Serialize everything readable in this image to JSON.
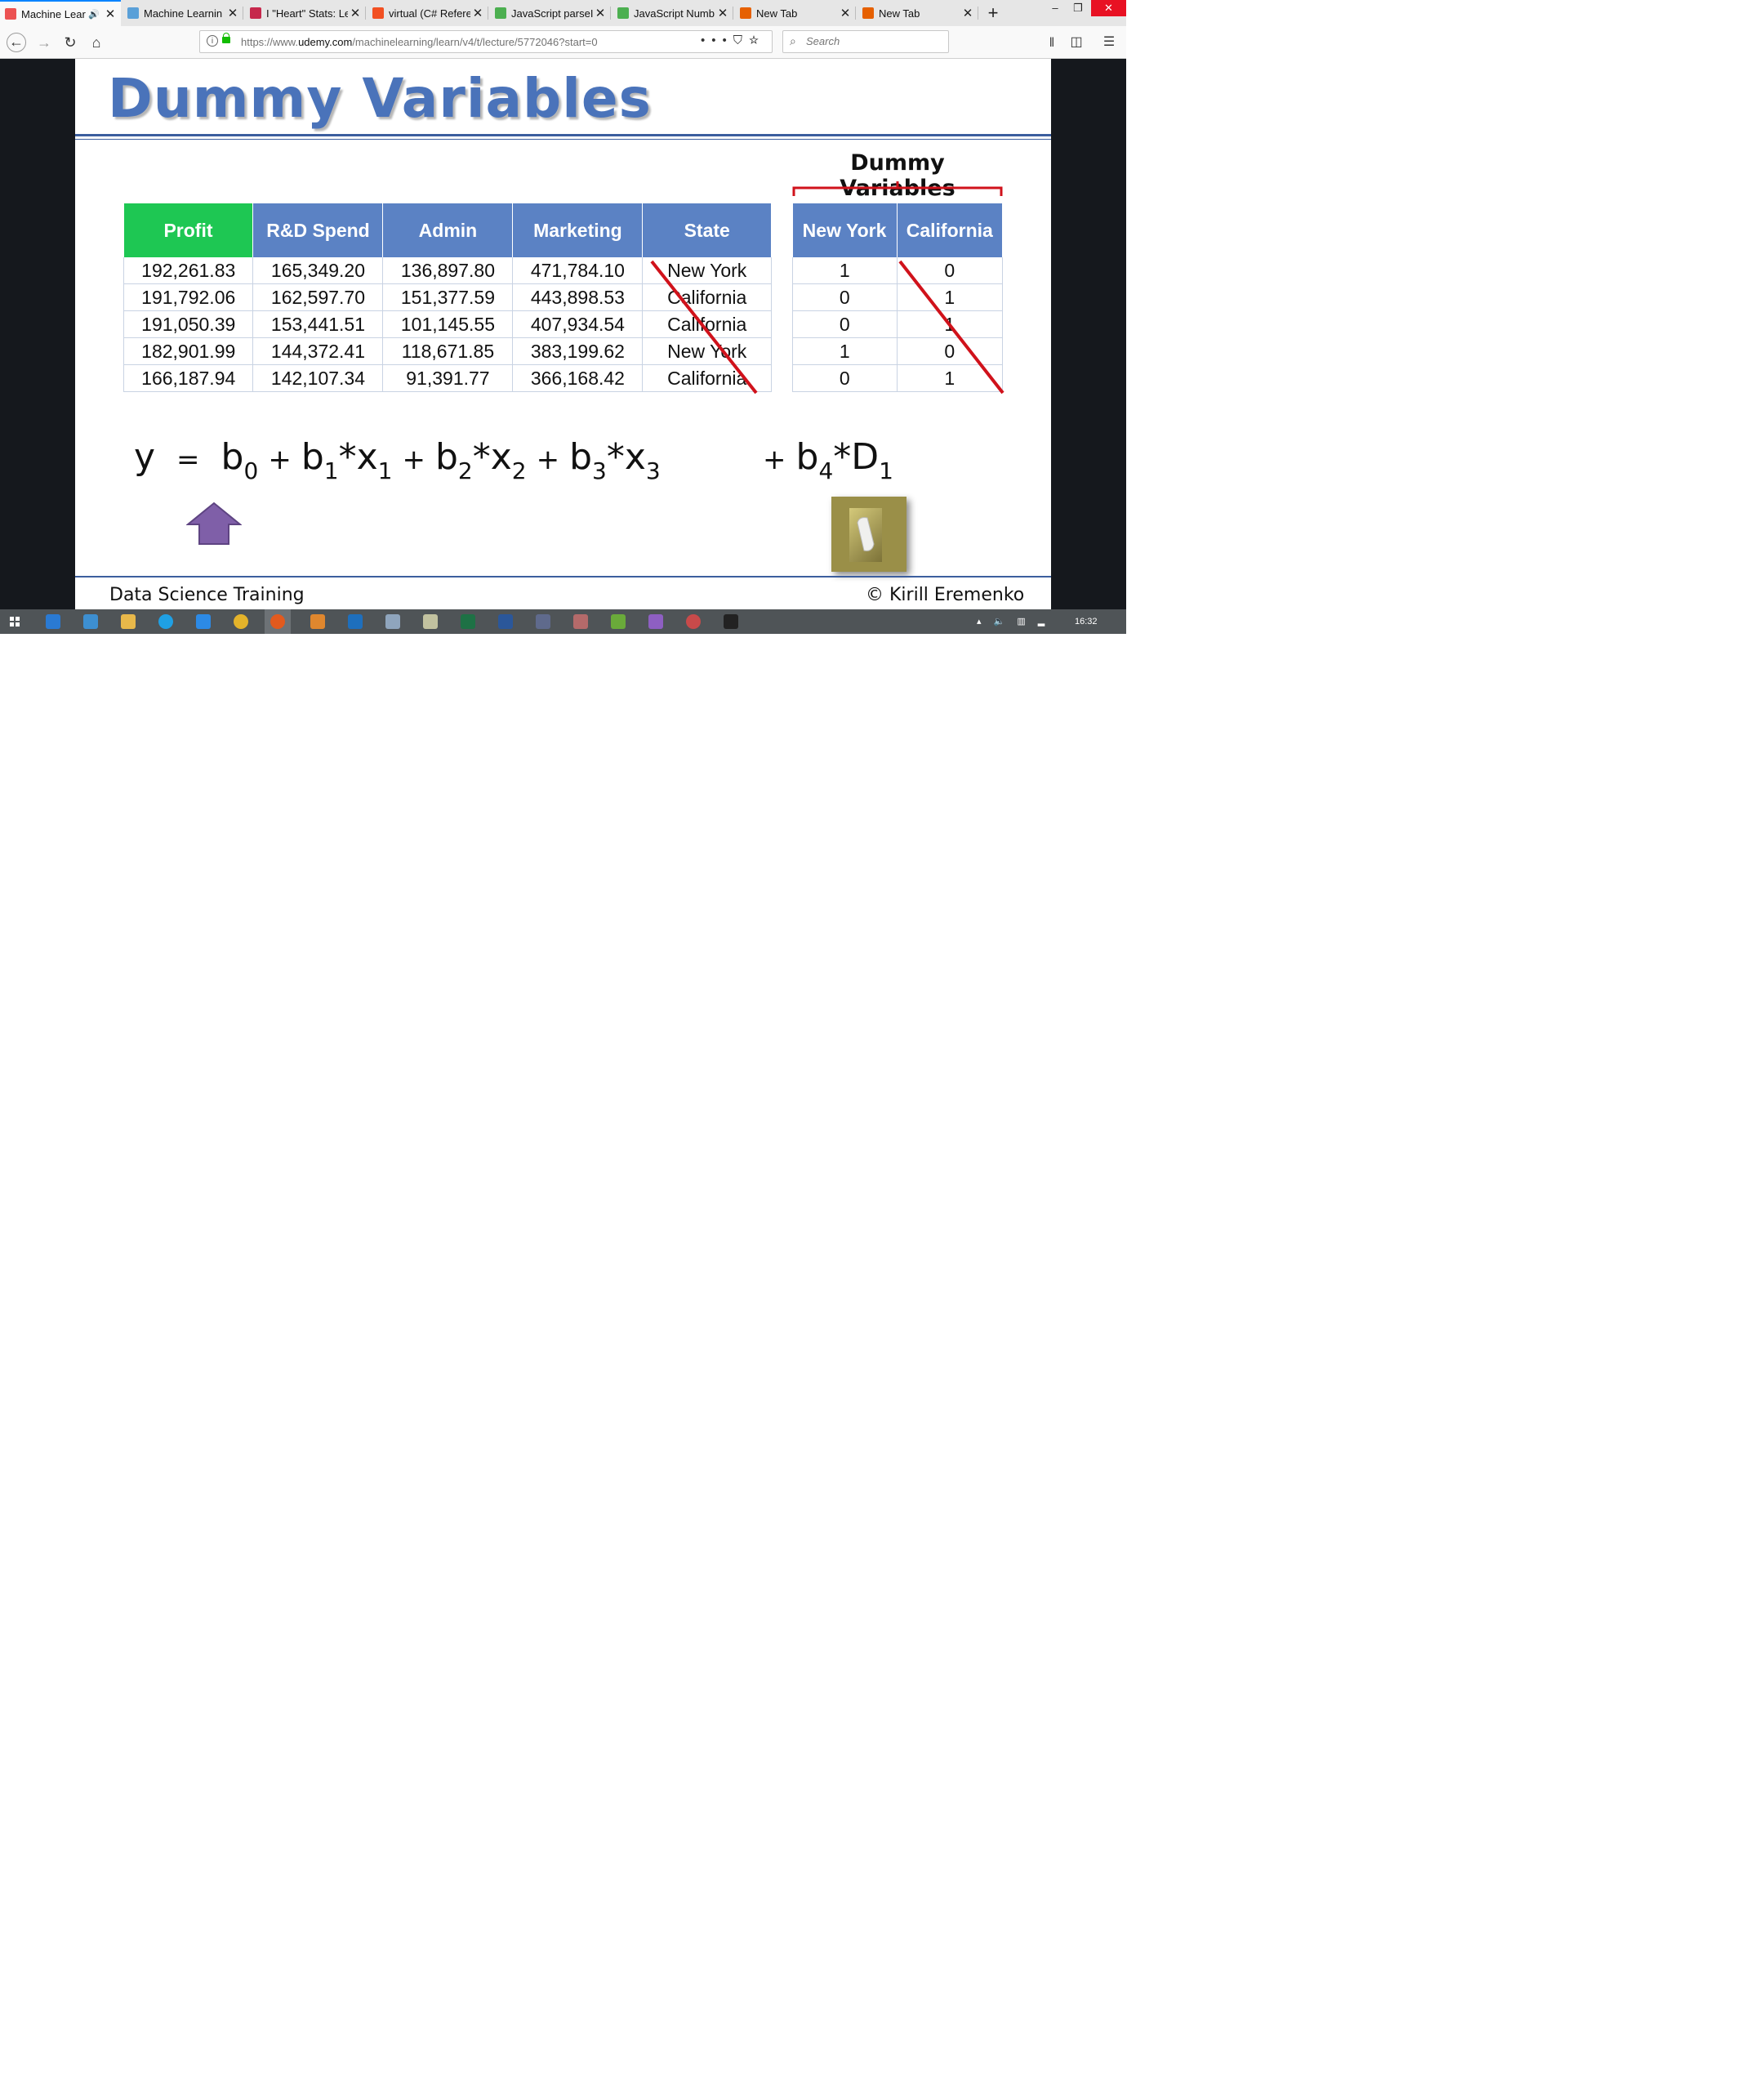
{
  "browser": {
    "tabs": [
      {
        "title": "Machine Lear",
        "active": true,
        "icon": "udemy-icon",
        "color": "#ec5252",
        "audio": true
      },
      {
        "title": "Machine Learnin",
        "active": false,
        "icon": "chat-icon",
        "color": "#5aa0d8"
      },
      {
        "title": "I \"Heart\" Stats: Le",
        "active": false,
        "icon": "edx-icon",
        "color": "#c6284c"
      },
      {
        "title": "virtual (C# Refere",
        "active": false,
        "icon": "microsoft-icon",
        "color": "#f25022"
      },
      {
        "title": "JavaScript parseI",
        "active": false,
        "icon": "w3schools-icon",
        "color": "#4caf50"
      },
      {
        "title": "JavaScript Numb",
        "active": false,
        "icon": "w3schools-icon",
        "color": "#4caf50"
      },
      {
        "title": "New Tab",
        "active": false,
        "icon": "firefox-icon",
        "color": "#e66000"
      },
      {
        "title": "New Tab",
        "active": false,
        "icon": "firefox-icon",
        "color": "#e66000"
      }
    ],
    "url_prefix": "https://www.",
    "url_domain": "udemy.com",
    "url_path": "/machinelearning/learn/v4/t/lecture/5772046?start=0",
    "search_placeholder": "Search"
  },
  "slide": {
    "title": "Dummy Variables",
    "main_table": {
      "headers": [
        "Profit",
        "R&D Spend",
        "Admin",
        "Marketing",
        "State"
      ],
      "rows": [
        [
          "192,261.83",
          "165,349.20",
          "136,897.80",
          "471,784.10",
          "New York"
        ],
        [
          "191,792.06",
          "162,597.70",
          "151,377.59",
          "443,898.53",
          "California"
        ],
        [
          "191,050.39",
          "153,441.51",
          "101,145.55",
          "407,934.54",
          "California"
        ],
        [
          "182,901.99",
          "144,372.41",
          "118,671.85",
          "383,199.62",
          "New York"
        ],
        [
          "166,187.94",
          "142,107.34",
          "91,391.77",
          "366,168.42",
          "California"
        ]
      ]
    },
    "dummy_heading": "Dummy Variables",
    "dummy_table": {
      "headers": [
        "New York",
        "California"
      ],
      "rows": [
        [
          "1",
          "0"
        ],
        [
          "0",
          "1"
        ],
        [
          "0",
          "1"
        ],
        [
          "1",
          "0"
        ],
        [
          "0",
          "1"
        ]
      ]
    },
    "equation": {
      "y": "y",
      "eq": "=",
      "terms": [
        {
          "coef": "b",
          "coef_sub": "0"
        },
        {
          "coef": "b",
          "coef_sub": "1",
          "var": "*x",
          "var_sub": "1"
        },
        {
          "coef": "b",
          "coef_sub": "2",
          "var": "*x",
          "var_sub": "2"
        },
        {
          "coef": "b",
          "coef_sub": "3",
          "var": "*x",
          "var_sub": "3"
        }
      ],
      "dummy_term": {
        "coef": "b",
        "coef_sub": "4",
        "var": "*D",
        "var_sub": "1"
      },
      "plus": "+"
    },
    "footer_left": "Data Science Training",
    "footer_right": "© Kirill Eremenko",
    "colors": {
      "header_blue": "#5b82c4",
      "profit_green": "#1ec753",
      "title_blue": "#4a73ba",
      "strike_red": "#d0121b",
      "arrow_purple": "#7f5fa8"
    }
  },
  "taskbar": {
    "clock": "16:32"
  }
}
